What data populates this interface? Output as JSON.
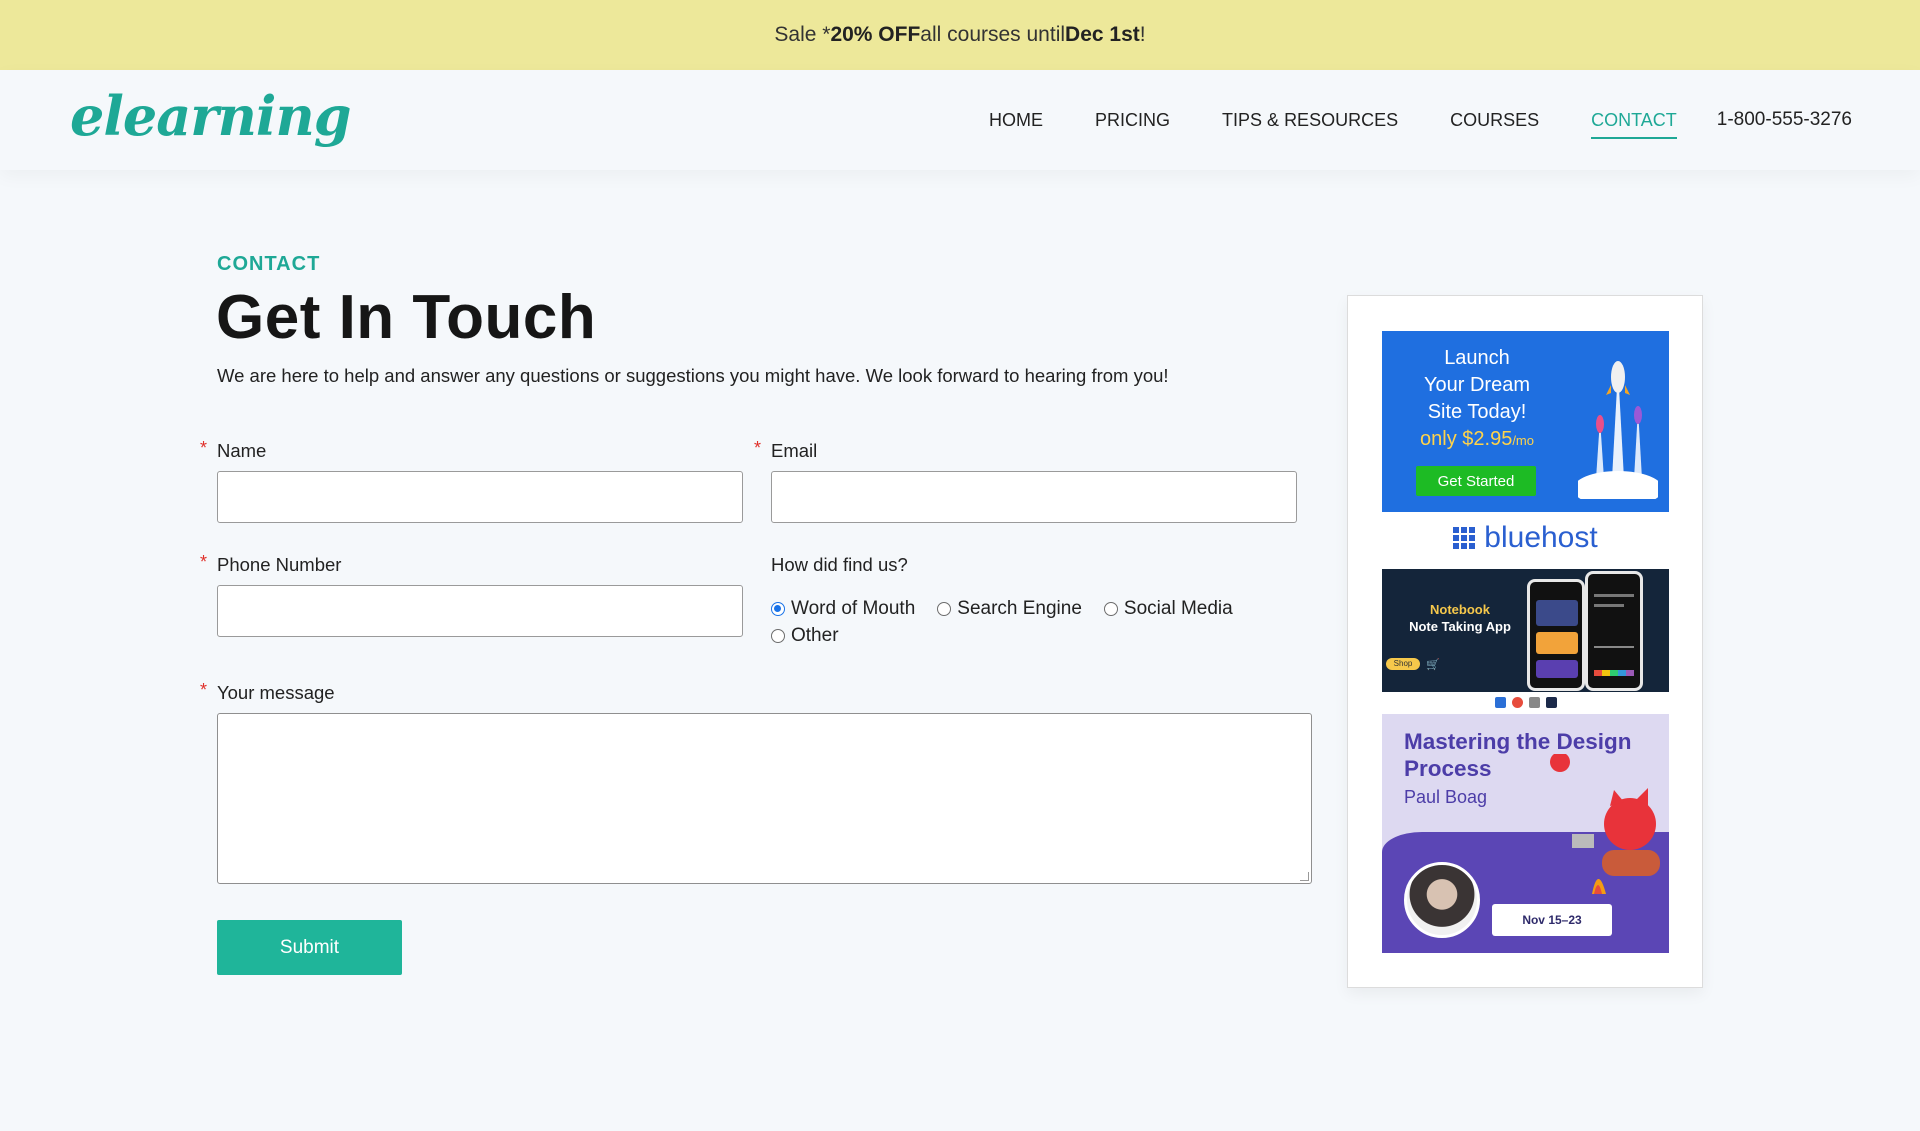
{
  "salebar": {
    "prefix": "Sale * ",
    "highlight": "20% OFF",
    "middle": " all courses until ",
    "date": "Dec 1st",
    "suffix": "!"
  },
  "header": {
    "logo": "elearning",
    "nav": [
      "HOME",
      "PRICING",
      "TIPS & RESOURCES",
      "COURSES",
      "CONTACT"
    ],
    "active": "CONTACT",
    "phone": "1-800-555-3276"
  },
  "main": {
    "eyebrow": "CONTACT",
    "title": "Get In Touch",
    "intro": "We are here to help and answer any questions or suggestions you might have. We look forward to hearing from you!",
    "required_mark": "*",
    "name_label": "Name",
    "email_label": "Email",
    "phone_label": "Phone Number",
    "find_label": "How did find us?",
    "radio_options": [
      "Word of Mouth",
      "Search Engine",
      "Social Media",
      "Other"
    ],
    "radio_selected": "Word of Mouth",
    "message_label": "Your message",
    "submit": "Submit"
  },
  "sidebar": {
    "ad1": {
      "line1": "Launch",
      "line2": "Your Dream",
      "line3": "Site Today!",
      "price": "only $2.95",
      "price_unit": "/mo",
      "button": "Get Started",
      "brand": "bluehost"
    },
    "ad2": {
      "title_top": "Notebook",
      "title_bottom": "Note Taking App",
      "shop": "Shop"
    },
    "ad3": {
      "title": "Mastering the Design Process",
      "author": "Paul Boag",
      "date": "Nov 15–23"
    }
  },
  "colors": {
    "accent": "#1ea896",
    "salebar": "#ede89a",
    "submit": "#1fb59a",
    "required": "#e0302a"
  }
}
